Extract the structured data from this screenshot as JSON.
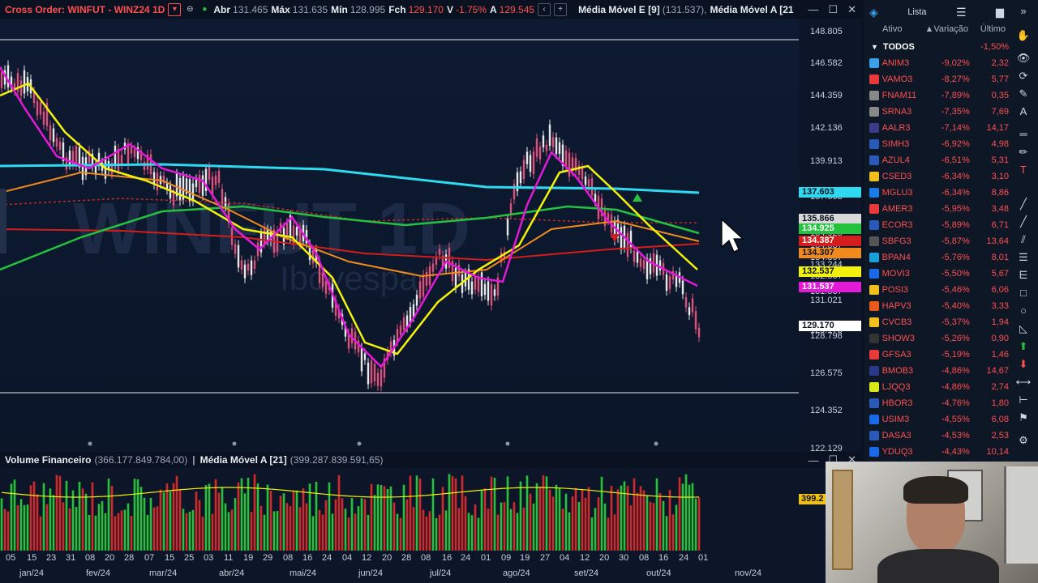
{
  "title_bar": {
    "symbol": "Cross Order: WINFUT - WINZ24 1D",
    "abr_label": "Abr",
    "abr_value": "131.465",
    "max_label": "Máx",
    "max_value": "131.635",
    "min_label": "Mín",
    "min_value": "128.995",
    "fch_label": "Fch",
    "fch_value": "129.170",
    "v_label": "V",
    "v_value": "-1.75%",
    "a_label": "A",
    "a_value": "129.545",
    "indicator1_label": "Média Móvel E [9]",
    "indicator1_value": "(131.537),",
    "indicator2_label": "Média Móvel A [21"
  },
  "price_scale": {
    "ticks": [
      "148.805",
      "146.582",
      "144.359",
      "142.136",
      "139.913",
      "137.603",
      "135.866",
      "134.925",
      "134.387",
      "134.307",
      "133.244",
      "132.537",
      "131.537",
      "131.021",
      "129.170",
      "128.798",
      "126.575",
      "124.352",
      "122.129"
    ],
    "tags": [
      {
        "value": "137.603",
        "color": "#2fd9f0",
        "text_color": "#0b1322"
      },
      {
        "value": "135.866",
        "color": "#d9d9d9",
        "text_color": "#0b1322"
      },
      {
        "value": "134.925",
        "color": "#25c23f",
        "text_color": "#ffffff"
      },
      {
        "value": "134.387",
        "color": "#d41d1d",
        "text_color": "#ffffff"
      },
      {
        "value": "134.307",
        "color": "#f08a1d",
        "text_color": "#0b1322"
      },
      {
        "value": "132.537",
        "color": "#f2f20c",
        "text_color": "#0b1322"
      },
      {
        "value": "131.537",
        "color": "#e21ad8",
        "text_color": "#ffffff"
      },
      {
        "value": "129.170",
        "color": "#ffffff",
        "text_color": "#0b1322"
      }
    ]
  },
  "watermark": {
    "line1": "WINFUT 1D",
    "line2": "Ibovespa"
  },
  "volume": {
    "label": "Volume Financeiro",
    "value": "(366.177.849.784,00)",
    "ma_label": "Média Móvel A [21]",
    "ma_value": "(399.287.839.591,65)",
    "scale_tag": "399.2"
  },
  "date_axis": {
    "days": [
      "05",
      "15",
      "23",
      "31",
      "08",
      "20",
      "28",
      "07",
      "15",
      "25",
      "03",
      "11",
      "19",
      "29",
      "08",
      "16",
      "24",
      "04",
      "12",
      "20",
      "28",
      "08",
      "16",
      "24",
      "01",
      "09",
      "19",
      "27",
      "04",
      "12",
      "20",
      "30",
      "08",
      "16",
      "24",
      "01"
    ],
    "months": [
      "jan/24",
      "fev/24",
      "mar/24",
      "abr/24",
      "mai/24",
      "jun/24",
      "jul/24",
      "ago/24",
      "set/24",
      "out/24",
      "nov/24"
    ]
  },
  "watchlist": {
    "tab_label": "Lista",
    "col_ativo": "Ativo",
    "col_variacao": "Variação",
    "col_ultimo": "Último",
    "group_name": "TODOS",
    "group_change": "-1,50%",
    "rows": [
      {
        "sym": "ANIM3",
        "chg": "-9,02%",
        "last": "2,32",
        "icon": "#3aa0e8"
      },
      {
        "sym": "VAMO3",
        "chg": "-8,27%",
        "last": "5,77",
        "icon": "#e83a3a"
      },
      {
        "sym": "FNAM11",
        "chg": "-7,89%",
        "last": "0,35",
        "icon": "#888888"
      },
      {
        "sym": "SRNA3",
        "chg": "-7,35%",
        "last": "7,69",
        "icon": "#888888"
      },
      {
        "sym": "AALR3",
        "chg": "-7,14%",
        "last": "14,17",
        "icon": "#3a3a8a"
      },
      {
        "sym": "SIMH3",
        "chg": "-6,92%",
        "last": "4,98",
        "icon": "#2a5ab8"
      },
      {
        "sym": "AZUL4",
        "chg": "-6,51%",
        "last": "5,31",
        "icon": "#2a5ab8"
      },
      {
        "sym": "CSED3",
        "chg": "-6,34%",
        "last": "3,10",
        "icon": "#f0c020"
      },
      {
        "sym": "MGLU3",
        "chg": "-6,34%",
        "last": "8,86",
        "icon": "#1a7ae8"
      },
      {
        "sym": "AMER3",
        "chg": "-5,95%",
        "last": "3,48",
        "icon": "#e83a3a"
      },
      {
        "sym": "ECOR3",
        "chg": "-5,89%",
        "last": "6,71",
        "icon": "#2a5ab8"
      },
      {
        "sym": "SBFG3",
        "chg": "-5,87%",
        "last": "13,64",
        "icon": "#555555"
      },
      {
        "sym": "BPAN4",
        "chg": "-5,76%",
        "last": "8,01",
        "icon": "#1aa0d8"
      },
      {
        "sym": "MOVI3",
        "chg": "-5,50%",
        "last": "5,67",
        "icon": "#1a6ae8"
      },
      {
        "sym": "POSI3",
        "chg": "-5,46%",
        "last": "6,06",
        "icon": "#f0c020"
      },
      {
        "sym": "HAPV3",
        "chg": "-5,40%",
        "last": "3,33",
        "icon": "#e85a1a"
      },
      {
        "sym": "CVCB3",
        "chg": "-5,37%",
        "last": "1,94",
        "icon": "#f0c020"
      },
      {
        "sym": "SHOW3",
        "chg": "-5,26%",
        "last": "0,90",
        "icon": "#333333"
      },
      {
        "sym": "GFSA3",
        "chg": "-5,19%",
        "last": "1,46",
        "icon": "#e83a3a"
      },
      {
        "sym": "BMOB3",
        "chg": "-4,86%",
        "last": "14,67",
        "icon": "#2a3a8a"
      },
      {
        "sym": "LJQQ3",
        "chg": "-4,86%",
        "last": "2,74",
        "icon": "#d8e81a"
      },
      {
        "sym": "HBOR3",
        "chg": "-4,76%",
        "last": "1,80",
        "icon": "#2a5ab8"
      },
      {
        "sym": "USIM3",
        "chg": "-4,55%",
        "last": "6,08",
        "icon": "#1a6ae8"
      },
      {
        "sym": "DASA3",
        "chg": "-4,53%",
        "last": "2,53",
        "icon": "#2a5ab8"
      },
      {
        "sym": "YDUQ3",
        "chg": "-4,43%",
        "last": "10,14",
        "icon": "#1a6ae8"
      }
    ]
  },
  "colors": {
    "ema9": "#e21ad8",
    "sma21": "#f2f20c",
    "ma_orange": "#f08a1d",
    "ma_green": "#25c23f",
    "ma_red": "#d41d1d",
    "ma_cyan": "#2fd9f0",
    "candle_up": "#e8e8e8",
    "candle_down": "#e0507a"
  }
}
